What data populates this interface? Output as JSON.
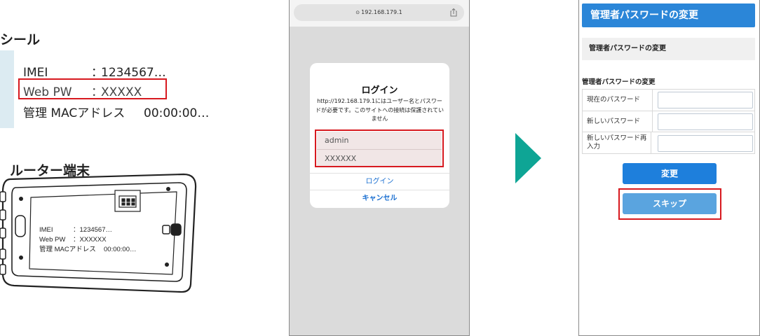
{
  "seal": {
    "title": "シール",
    "rows": [
      {
        "label": "IMEI",
        "sep": "：",
        "value": "1234567…"
      },
      {
        "label": "Web PW",
        "sep": "：",
        "value": "XXXXX"
      },
      {
        "label": "管理 MACアドレス",
        "sep": "",
        "value": "00:00:00…"
      }
    ]
  },
  "router": {
    "title": "ルーター端末",
    "rows": [
      {
        "label": "IMEI",
        "sep": "：",
        "value": "1234567…"
      },
      {
        "label": "Web PW",
        "sep": "：",
        "value": "XXXXXX"
      },
      {
        "label": "管理 MACアドレス",
        "sep": "",
        "value": "00:00:00…"
      }
    ]
  },
  "browser": {
    "url": "192.168.179.1",
    "dialog": {
      "title": "ログイン",
      "message": "http://192.168.179.1にはユーザー名とパスワードが必要です。このサイトへの接続は保護されていません",
      "username": "admin",
      "password": "XXXXXX",
      "login_label": "ログイン",
      "cancel_label": "キャンセル"
    }
  },
  "admin": {
    "header": "管理者パスワードの変更",
    "subheader": "管理者パスワードの変更",
    "section": "管理者パスワードの変更",
    "fields": [
      {
        "label": "現在のパスワード",
        "value": ""
      },
      {
        "label": "新しいパスワード",
        "value": ""
      },
      {
        "label": "新しいパスワード再入力",
        "value": ""
      }
    ],
    "change_label": "変更",
    "skip_label": "スキップ"
  },
  "colors": {
    "highlight": "#d7191f",
    "arrow": "#0ea595",
    "header_blue": "#2b86d8",
    "button_blue": "#1e7fdc",
    "skip_blue": "#5aa4df",
    "link_blue": "#1a6fd1"
  },
  "icons": {
    "share": "share-icon",
    "lock": "lock-icon",
    "arrow": "next-arrow-icon"
  }
}
